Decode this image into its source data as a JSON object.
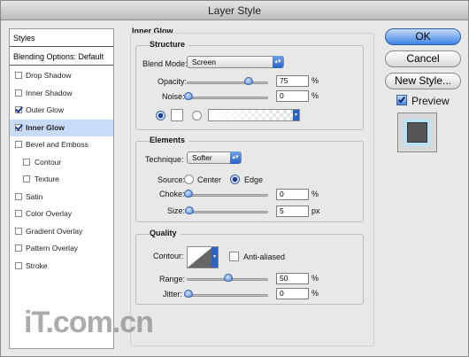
{
  "window": {
    "title": "Layer Style"
  },
  "styles_panel": {
    "header": "Styles",
    "blending_options": "Blending Options: Default",
    "items": [
      {
        "label": "Drop Shadow",
        "checked": false,
        "indent": false,
        "selected": false
      },
      {
        "label": "Inner Shadow",
        "checked": false,
        "indent": false,
        "selected": false
      },
      {
        "label": "Outer Glow",
        "checked": true,
        "indent": false,
        "selected": false
      },
      {
        "label": "Inner Glow",
        "checked": true,
        "indent": false,
        "selected": true
      },
      {
        "label": "Bevel and Emboss",
        "checked": false,
        "indent": false,
        "selected": false
      },
      {
        "label": "Contour",
        "checked": false,
        "indent": true,
        "selected": false
      },
      {
        "label": "Texture",
        "checked": false,
        "indent": true,
        "selected": false
      },
      {
        "label": "Satin",
        "checked": false,
        "indent": false,
        "selected": false
      },
      {
        "label": "Color Overlay",
        "checked": false,
        "indent": false,
        "selected": false
      },
      {
        "label": "Gradient Overlay",
        "checked": false,
        "indent": false,
        "selected": false
      },
      {
        "label": "Pattern Overlay",
        "checked": false,
        "indent": false,
        "selected": false
      },
      {
        "label": "Stroke",
        "checked": false,
        "indent": false,
        "selected": false
      }
    ]
  },
  "inner_glow": {
    "section_title": "Inner Glow",
    "structure": {
      "title": "Structure",
      "blend_mode_label": "Blend Mode:",
      "blend_mode_value": "Screen",
      "opacity_label": "Opacity:",
      "opacity_value": "75",
      "opacity_unit": "%",
      "noise_label": "Noise:",
      "noise_value": "0",
      "noise_unit": "%"
    },
    "elements": {
      "title": "Elements",
      "technique_label": "Technique:",
      "technique_value": "Softer",
      "source_label": "Source:",
      "source_center": "Center",
      "source_edge": "Edge",
      "choke_label": "Choke:",
      "choke_value": "0",
      "choke_unit": "%",
      "size_label": "Size:",
      "size_value": "5",
      "size_unit": "px"
    },
    "quality": {
      "title": "Quality",
      "contour_label": "Contour:",
      "anti_aliased_label": "Anti-aliased",
      "range_label": "Range:",
      "range_value": "50",
      "range_unit": "%",
      "jitter_label": "Jitter:",
      "jitter_value": "0",
      "jitter_unit": "%"
    }
  },
  "buttons": {
    "ok": "OK",
    "cancel": "Cancel",
    "new_style": "New Style...",
    "preview": "Preview"
  },
  "watermark": "iT.com.cn",
  "colors": {
    "accent": "#3f84e3",
    "selected_row": "#c9dcf7",
    "glow": "#aee6ff"
  }
}
